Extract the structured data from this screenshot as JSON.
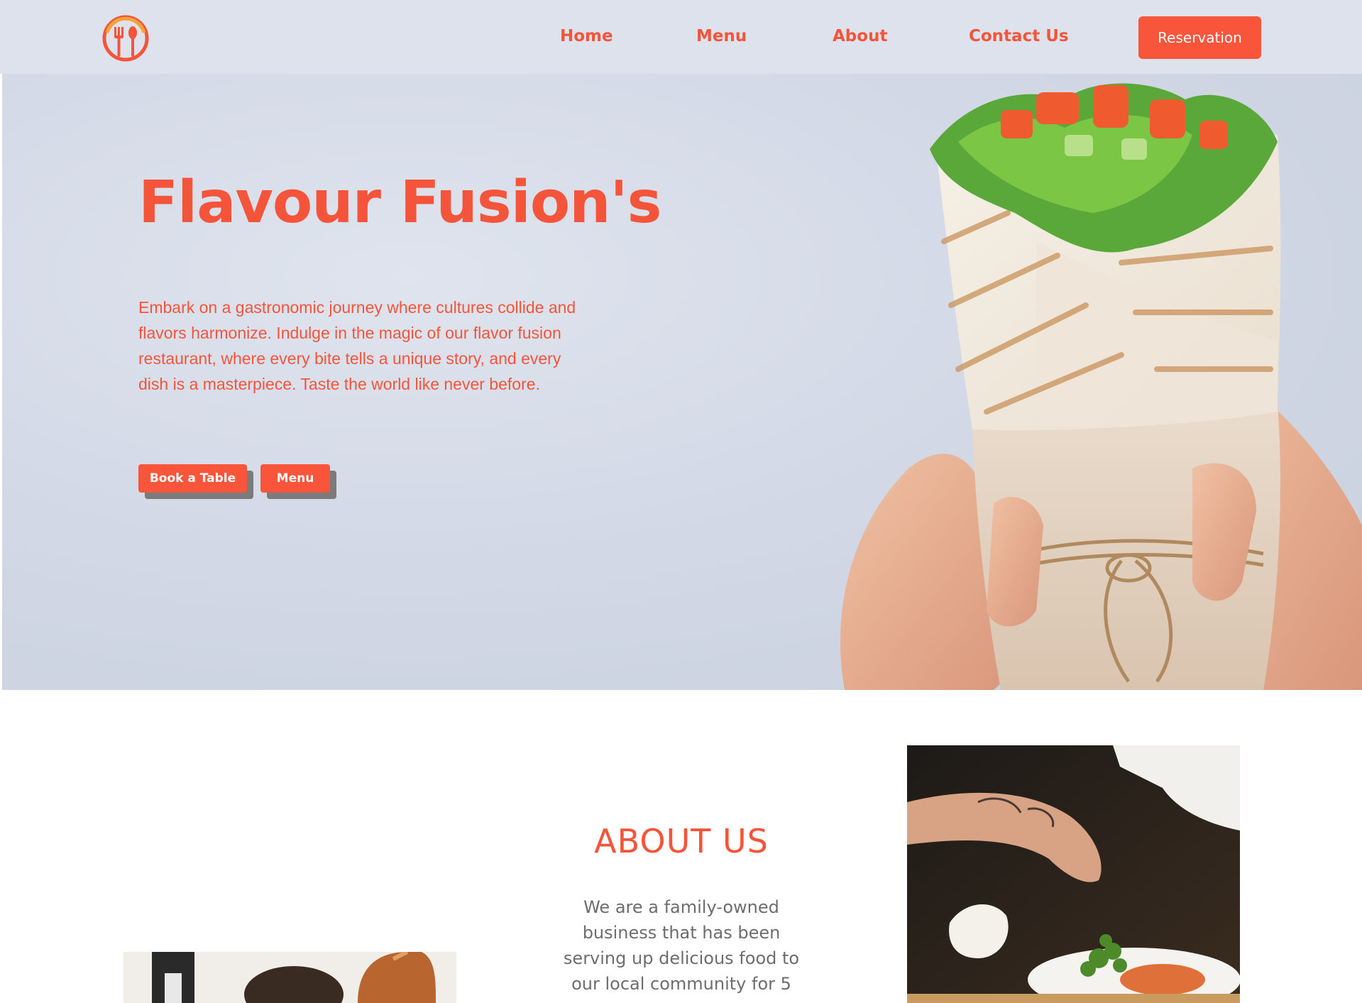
{
  "nav": {
    "logo_icon": "fork-spoon-plate-logo",
    "links": [
      "Home",
      "Menu",
      "About",
      "Contact Us"
    ],
    "reservation": "Reservation"
  },
  "hero": {
    "title": "Flavour Fusion's",
    "description": "Embark on a gastronomic journey where cultures collide and flavors harmonize. Indulge in the magic of our flavor fusion restaurant, where every bite tells a unique story, and every dish is a masterpiece. Taste the world like never before.",
    "buttons": [
      "Book a Table",
      "Menu"
    ],
    "image": "hands-holding-vegetable-wrap"
  },
  "about": {
    "title": "ABOUT US",
    "text": "We are a family-owned business that has been serving up delicious food to our local community for 5",
    "image_right": "chef-plating-dish",
    "image_left": "chef-cooking-kitchen"
  },
  "colors": {
    "accent": "#f9553b",
    "accent_text": "#f4553a",
    "hero_bg": "#d3d9e6",
    "body_text": "#6d6d6d",
    "button_shadow": "#7b7b7b"
  }
}
